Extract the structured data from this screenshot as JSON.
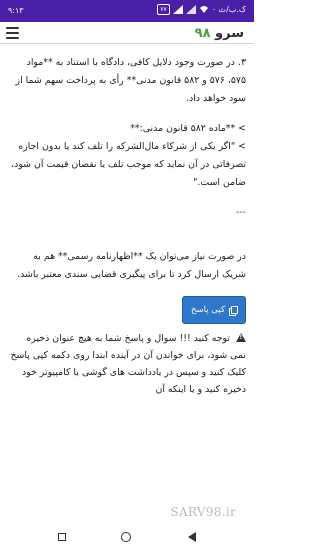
{
  "status_bar": {
    "time": "۹:۱۳",
    "net_speed": "۰ ک.ب/ث",
    "battery": "۷۷"
  },
  "app_bar": {
    "brand_word": "سرو",
    "brand_number": "۹۸"
  },
  "content": {
    "paragraph_1": "۳. در صورت وجود دلایل کافی، دادگاه با استناد به **مواد ۵۷۵، ۵۷۶ و ۵۸۲ قانون مدنی** رأی به پرداخت سهم شما از سود خواهد داد.",
    "quote_title": "> **ماده ۵۸۲ قانون مدنی:**",
    "quote_body": "> \"اگر یکی از شرکاء مال‌الشرکه را تلف کند یا بدون اجازه تصرفاتی در آن نماید که موجب تلف یا نقصان قیمت آن شود، ضامن است.\"",
    "separator": "---",
    "paragraph_2": "در صورت نیاز می‌توان یک **اظهارنامه رسمی** هم به شریک ارسال کرد تا برای پیگیری قضایی سندی معتبر باشد.",
    "copy_button_label": "کپی پاسخ",
    "warning_text": "توجه کنید !!! سوال و پاسخ شما به هیچ عنوان ذخیره نمی شود، برای خواندن آن در آینده ابتدا روی دکمه کپی پاسخ کلیک کنید و سپس در یادداشت های گوشی یا کامپیوتر خود ذخیره کنید و یا اینکه آن",
    "watermark": "SARV98.ir"
  },
  "colors": {
    "status_bar": "#4a1fa8",
    "brand_number": "#4ea13a",
    "copy_button": "#2f77c9"
  }
}
